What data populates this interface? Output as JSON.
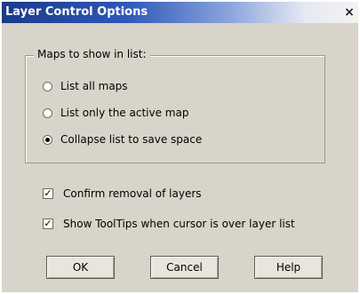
{
  "window": {
    "title": "Layer Control Options",
    "close_glyph": "×"
  },
  "group": {
    "label": "Maps to show in list:",
    "options": [
      {
        "label": "List all maps",
        "selected": false
      },
      {
        "label": "List only the active map",
        "selected": false
      },
      {
        "label": "Collapse list to save space",
        "selected": true
      }
    ]
  },
  "checkboxes": [
    {
      "label": "Confirm removal of layers",
      "checked": true
    },
    {
      "label": "Show ToolTips when cursor is over layer list",
      "checked": true
    }
  ],
  "buttons": {
    "ok": "OK",
    "cancel": "Cancel",
    "help": "Help"
  },
  "check_glyph": "✓",
  "colors": {
    "titlebar_start": "#1b3a8a",
    "dialog_bg": "#d8d4ca"
  }
}
